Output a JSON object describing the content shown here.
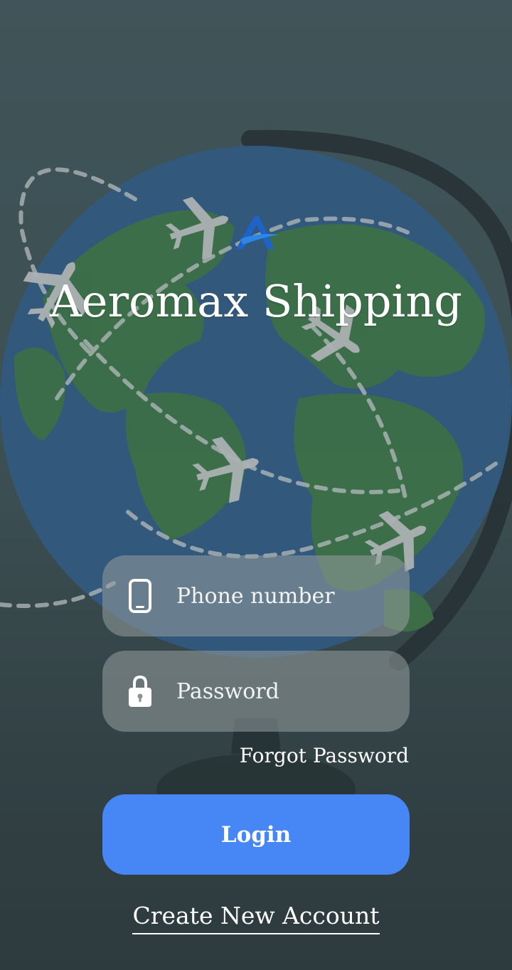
{
  "app": {
    "title": "Aeromax Shipping",
    "logo_icon": "aeromax-logo-icon"
  },
  "background": {
    "icon": "globe-with-airplanes-illustration"
  },
  "form": {
    "phone": {
      "icon": "phone-icon",
      "placeholder": "Phone number",
      "value": ""
    },
    "password": {
      "icon": "lock-icon",
      "placeholder": "Password",
      "value": ""
    },
    "forgot_password_label": "Forgot Password",
    "login_label": "Login",
    "create_account_label": "Create New Account"
  },
  "colors": {
    "primary_button": "#4687f5",
    "field_background": "rgba(150,158,160,0.55)",
    "text": "#ffffff",
    "ocean": "#2f5f8f",
    "land": "#3f7d45"
  }
}
